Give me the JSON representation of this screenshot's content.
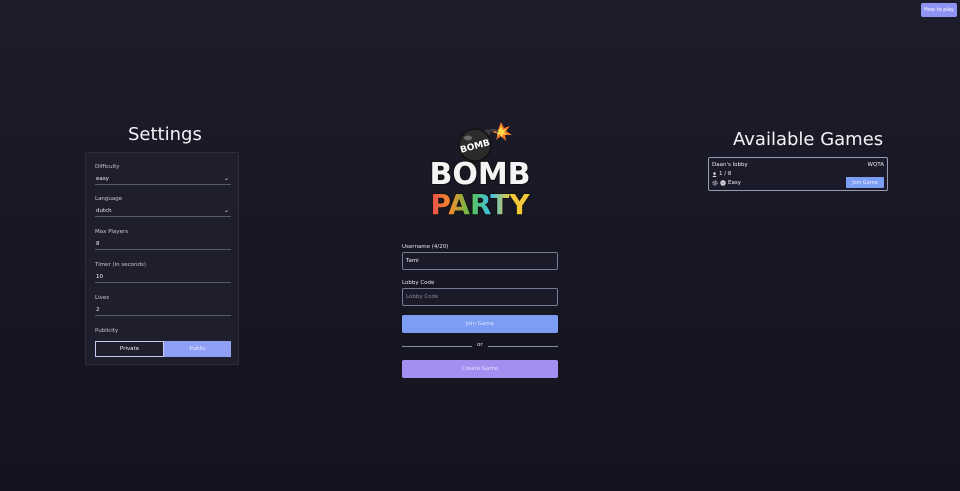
{
  "header": {
    "how_to_play": "How to play"
  },
  "settings": {
    "title": "Settings",
    "difficulty": {
      "label": "Difficulty",
      "value": "easy"
    },
    "language": {
      "label": "Language",
      "value": "dutch"
    },
    "max_players": {
      "label": "Max Players",
      "value": "8"
    },
    "timer": {
      "label": "Timer (in seconds)",
      "value": "10"
    },
    "lives": {
      "label": "Lives",
      "value": "2"
    },
    "publicity": {
      "label": "Publicity",
      "private": "Private",
      "public": "Public",
      "selected": "Public"
    }
  },
  "logo": {
    "line1": "BOMB",
    "line2": "PARTY",
    "bomb_text": "BOMB"
  },
  "form": {
    "username_label": "Username (4/20)",
    "username_value": "Tami",
    "lobby_label": "Lobby Code",
    "lobby_placeholder": "Lobby Code",
    "join_button": "Join Game",
    "or_text": "or",
    "create_button": "Create Game"
  },
  "games": {
    "title": "Available Games",
    "list": [
      {
        "name": "Daan's lobby",
        "code": "WQTA",
        "players": "1 / 8",
        "difficulty": "Easy",
        "join_label": "Join Game"
      }
    ]
  },
  "colors": {
    "background": "#181824",
    "primary": "#7b9df4",
    "secondary": "#a38ff0",
    "accent": "#8f93f3"
  }
}
